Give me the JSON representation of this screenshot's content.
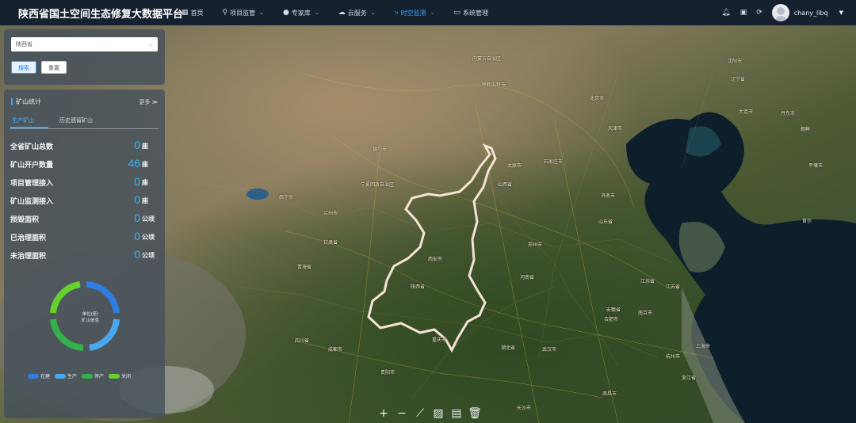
{
  "app": {
    "title": "陕西省国土空间生态修复大数据平台"
  },
  "nav": [
    {
      "icon": "home-icon",
      "glyph": "▦",
      "label": "首页",
      "dropdown": false,
      "active": false
    },
    {
      "icon": "link-icon",
      "glyph": "⚲",
      "label": "项目监管",
      "dropdown": true,
      "active": false
    },
    {
      "icon": "person-icon",
      "glyph": "●",
      "label": "专家库",
      "dropdown": true,
      "active": false
    },
    {
      "icon": "cloud-icon",
      "glyph": "☁",
      "label": "云服务",
      "dropdown": true,
      "active": false
    },
    {
      "icon": "branch-icon",
      "glyph": "⤷",
      "label": "时空监测",
      "dropdown": true,
      "active": true
    },
    {
      "icon": "monitor-icon",
      "glyph": "▭",
      "label": "系统管理",
      "dropdown": false,
      "active": false
    }
  ],
  "user": {
    "name": "chany_libq"
  },
  "region": {
    "selected": "陕西省",
    "search_label": "搜索",
    "reset_label": "重置"
  },
  "stats": {
    "title": "矿山统计",
    "more_label": "更多 ≫",
    "tabs": [
      "生产矿山",
      "历史遗留矿山"
    ],
    "rows": [
      {
        "label": "全省矿山总数",
        "value": "0",
        "unit": "座"
      },
      {
        "label": "矿山开户数量",
        "value": "46",
        "unit": "座"
      },
      {
        "label": "项目管理接入",
        "value": "0",
        "unit": "座"
      },
      {
        "label": "矿山监测接入",
        "value": "0",
        "unit": "座"
      },
      {
        "label": "损毁面积",
        "value": "0",
        "unit": "公顷"
      },
      {
        "label": "已治理面积",
        "value": "0",
        "unit": "公顷"
      },
      {
        "label": "未治理面积",
        "value": "0",
        "unit": "公顷"
      }
    ],
    "ring": {
      "line1": "单位(座)",
      "line2": "矿山信息"
    },
    "legend": [
      {
        "label": "在建",
        "color": "#2f7de1"
      },
      {
        "label": "生产",
        "color": "#4aa8f0"
      },
      {
        "label": "停产",
        "color": "#33b34a"
      },
      {
        "label": "关闭",
        "color": "#66d12c"
      }
    ]
  },
  "map": {
    "labels": [
      {
        "text": "内蒙古自治区"
      },
      {
        "text": "呼和浩特市"
      },
      {
        "text": "北京市"
      },
      {
        "text": "天津市"
      },
      {
        "text": "石家庄市"
      },
      {
        "text": "太原市"
      },
      {
        "text": "银川市"
      },
      {
        "text": "宁夏回族自治区"
      },
      {
        "text": "山西省"
      },
      {
        "text": "西宁市"
      },
      {
        "text": "兰州市"
      },
      {
        "text": "甘肃省"
      },
      {
        "text": "西安市"
      },
      {
        "text": "陕西省"
      },
      {
        "text": "郑州市"
      },
      {
        "text": "河南省"
      },
      {
        "text": "济南市"
      },
      {
        "text": "山东省"
      },
      {
        "text": "江苏省"
      },
      {
        "text": "南京市"
      },
      {
        "text": "合肥市"
      },
      {
        "text": "安徽省"
      },
      {
        "text": "上海市"
      },
      {
        "text": "杭州市"
      },
      {
        "text": "武汉市"
      },
      {
        "text": "湖北省"
      },
      {
        "text": "重庆市"
      },
      {
        "text": "成都市"
      },
      {
        "text": "四川省"
      },
      {
        "text": "长沙市"
      },
      {
        "text": "南昌市"
      },
      {
        "text": "贵阳市"
      },
      {
        "text": "沈阳市"
      },
      {
        "text": "辽宁省"
      },
      {
        "text": "大连市"
      },
      {
        "text": "平壤市"
      },
      {
        "text": "首尔"
      },
      {
        "text": "朝鲜"
      },
      {
        "text": "丹东市"
      },
      {
        "text": "青海省"
      },
      {
        "text": "江苏省"
      },
      {
        "text": "浙江省"
      }
    ]
  },
  "map_tools": [
    {
      "name": "zoom-in-icon",
      "glyph": "+"
    },
    {
      "name": "zoom-out-icon",
      "glyph": "−"
    },
    {
      "name": "measure-line-icon",
      "glyph": "⟋"
    },
    {
      "name": "measure-area-icon",
      "glyph": "▨"
    },
    {
      "name": "draw-rect-icon",
      "glyph": "▤"
    },
    {
      "name": "delete-icon",
      "glyph": "🗑"
    }
  ]
}
